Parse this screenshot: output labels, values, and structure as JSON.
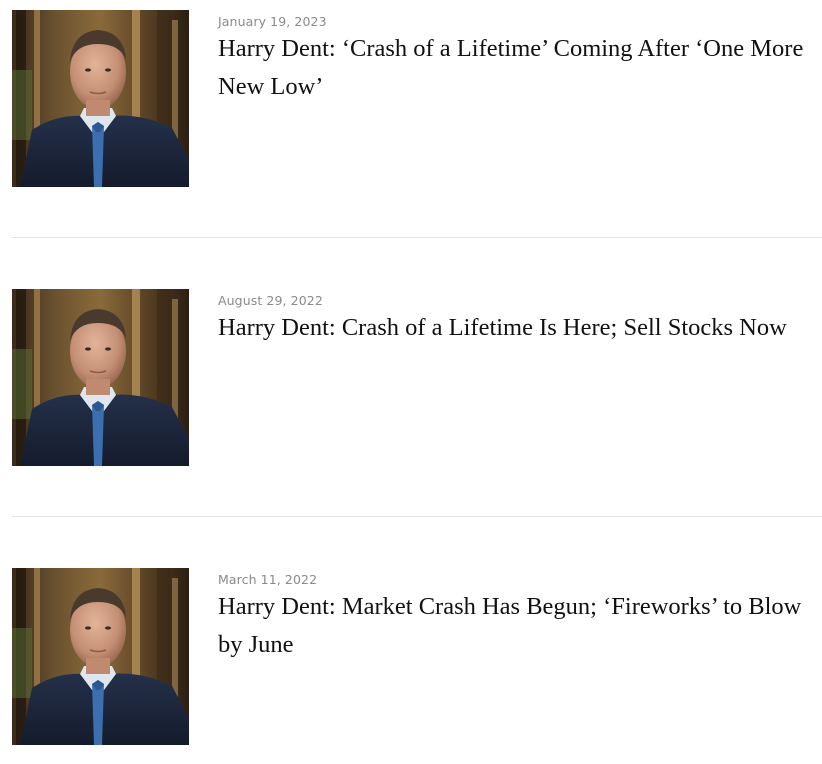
{
  "articles": [
    {
      "date": "January 19, 2023",
      "title": "Harry Dent: ‘Crash of a Lifetime’ Coming After ‘One More New Low’",
      "image": "harry-dent-portrait"
    },
    {
      "date": "August 29, 2022",
      "title": "Harry Dent: Crash of a Lifetime Is Here; Sell Stocks Now",
      "image": "harry-dent-portrait"
    },
    {
      "date": "March 11, 2022",
      "title": "Harry Dent: Market Crash Has Begun; ‘Fireworks’ to Blow by June",
      "image": "harry-dent-portrait"
    }
  ],
  "colors": {
    "date": "#8a8a8a",
    "title": "#111111",
    "divider": "#e3e3e3"
  }
}
